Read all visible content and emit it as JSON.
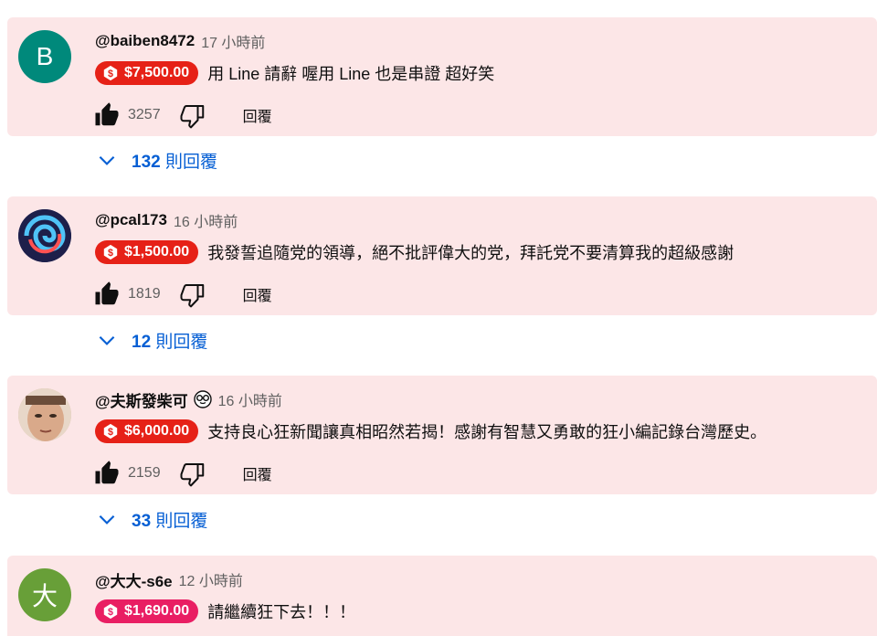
{
  "colors": {
    "chip_red": "#e62117",
    "chip_pink": "#e91e63",
    "link_blue": "#065fd4",
    "card_bg": "#fce6e7"
  },
  "comments": [
    {
      "avatar_letter": "B",
      "avatar_color": "#00897b",
      "author": "@baiben8472",
      "time": "17 小時前",
      "amount": "$7,500.00",
      "chip_color": "#e62117",
      "text": "用 Line 請辭 喔用 Line 也是串證 超好笑",
      "likes": "3257",
      "reply_label": "回覆",
      "replies_count": "132",
      "replies_label": "則回覆"
    },
    {
      "avatar_letter": "",
      "avatar_color": "#2b2f66",
      "author": "@pcal173",
      "time": "16 小時前",
      "amount": "$1,500.00",
      "chip_color": "#e62117",
      "text": "我發誓追隨党的領導，絕不批評偉大的党，拜託党不要清算我的超級感謝",
      "likes": "1819",
      "reply_label": "回覆",
      "replies_count": "12",
      "replies_label": "則回覆"
    },
    {
      "avatar_letter": "",
      "avatar_color": "#d9b7a0",
      "author": "@夫斯發柴可",
      "time": "16 小時前",
      "emoji_icon": "nerd-face-icon",
      "amount": "$6,000.00",
      "chip_color": "#e62117",
      "text": "支持良心狂新聞讓真相昭然若揭！感謝有智慧又勇敢的狂小編記錄台灣歷史。",
      "likes": "2159",
      "reply_label": "回覆",
      "replies_count": "33",
      "replies_label": "則回覆"
    },
    {
      "avatar_letter": "大",
      "avatar_color": "#689f38",
      "author": "@大大-s6e",
      "time": "12 小時前",
      "amount": "$1,690.00",
      "chip_color": "#e91e63",
      "text": "請繼續狂下去！！！"
    }
  ]
}
